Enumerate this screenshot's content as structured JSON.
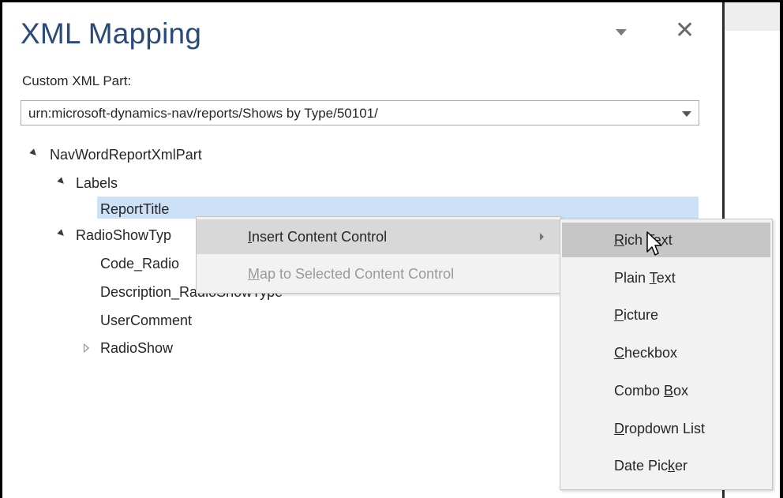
{
  "pane": {
    "title": "XML Mapping",
    "custom_part_label": "Custom XML Part:",
    "custom_part_value": "urn:microsoft-dynamics-nav/reports/Shows by Type/50101/"
  },
  "tree": {
    "root": "NavWordReportXmlPart",
    "labels": "Labels",
    "report_title": "ReportTitle",
    "radio_show_type": "RadioShowTyp",
    "code_radio": "Code_Radio",
    "description": "Description_RadioShowType",
    "user_comment": "UserComment",
    "radio_show": "RadioShow"
  },
  "context_menu": {
    "insert": {
      "pre": "",
      "u": "I",
      "post": "nsert Content Control"
    },
    "map": {
      "pre": "",
      "u": "M",
      "post": "ap to Selected Content Control"
    }
  },
  "submenu": {
    "rich_text": {
      "pre": "",
      "u": "R",
      "post": "ich Text"
    },
    "plain_text": {
      "pre": "Plain ",
      "u": "T",
      "post": "ext"
    },
    "picture": {
      "pre": "",
      "u": "P",
      "post": "icture"
    },
    "checkbox": {
      "pre": "",
      "u": "C",
      "post": "heckbox"
    },
    "combo_box": {
      "pre": "Combo ",
      "u": "B",
      "post": "ox"
    },
    "dropdown_list": {
      "pre": "",
      "u": "D",
      "post": "ropdown List"
    },
    "date_picker": {
      "pre": "Date Pic",
      "u": "k",
      "post": "er"
    }
  },
  "colors": {
    "title": "#2b4a7a",
    "selection": "#cce0f7",
    "menu_bg": "#f2f2f2",
    "menu_hover": "#c6c6c6",
    "disabled_text": "#9a9a9a"
  },
  "icons": [
    "pane-options-dropdown-icon",
    "close-icon",
    "expand-triangle-icon",
    "collapse-triangle-icon",
    "submenu-arrow-icon",
    "mouse-pointer-icon"
  ]
}
